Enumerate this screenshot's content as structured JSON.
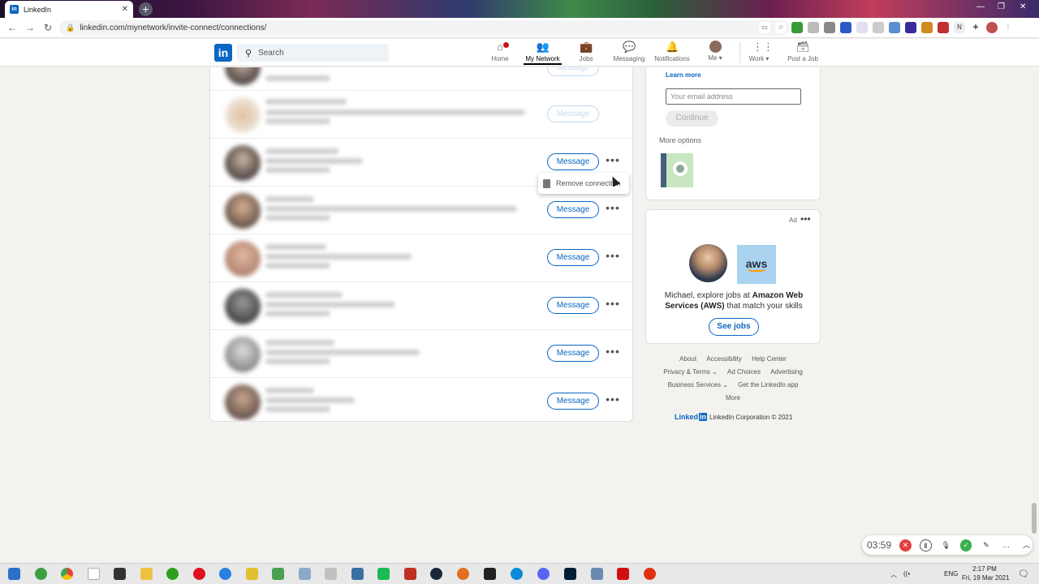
{
  "browser": {
    "tab_title": "LinkedIn",
    "tab_close": "✕",
    "new_tab": "+",
    "url": "linkedin.com/mynetwork/invite-connect/connections/"
  },
  "header": {
    "logo": "in",
    "search_placeholder": "Search",
    "nav": [
      {
        "label": "Home",
        "icon": "home-icon"
      },
      {
        "label": "My Network",
        "icon": "people-icon"
      },
      {
        "label": "Jobs",
        "icon": "briefcase-icon"
      },
      {
        "label": "Messaging",
        "icon": "chat-icon"
      },
      {
        "label": "Notifications",
        "icon": "bell-icon"
      },
      {
        "label": "Me",
        "icon": "avatar"
      },
      {
        "label": "Work",
        "icon": "grid-icon"
      },
      {
        "label": "Post a Job",
        "icon": "briefcase-plus-icon"
      }
    ]
  },
  "connections": {
    "message_label": "Message",
    "more_label": "•••",
    "dropdown": {
      "label": "Remove connection"
    }
  },
  "rail": {
    "learn_more": "Learn more",
    "email_placeholder": "Your email address",
    "continue_label": "Continue",
    "more_options": "More options"
  },
  "ad": {
    "label": "Ad",
    "more": "•••",
    "aws": "aws",
    "text_1": "Michael, explore jobs at ",
    "text_bold": "Amazon Web Services (AWS)",
    "text_2": " that match your skills",
    "button": "See jobs"
  },
  "footer": {
    "line1": [
      "About",
      "Accessibility",
      "Help Center"
    ],
    "line2": [
      "Privacy & Terms ⌄",
      "Ad Choices",
      "Advertising"
    ],
    "line3": [
      "Business Services ⌄",
      "Get the LinkedIn app"
    ],
    "line4": [
      "More"
    ],
    "brand": "Linked",
    "brand_in": "in",
    "copyright": "LinkedIn Corporation © 2021"
  },
  "recorder": {
    "time": "03:59"
  },
  "taskbar": {
    "lang": "ENG",
    "time": "2:17 PM",
    "date": "Fri, 19 Mar 2021"
  },
  "colors": {
    "brand": "#0a66c2",
    "badge": "#cc1016"
  }
}
